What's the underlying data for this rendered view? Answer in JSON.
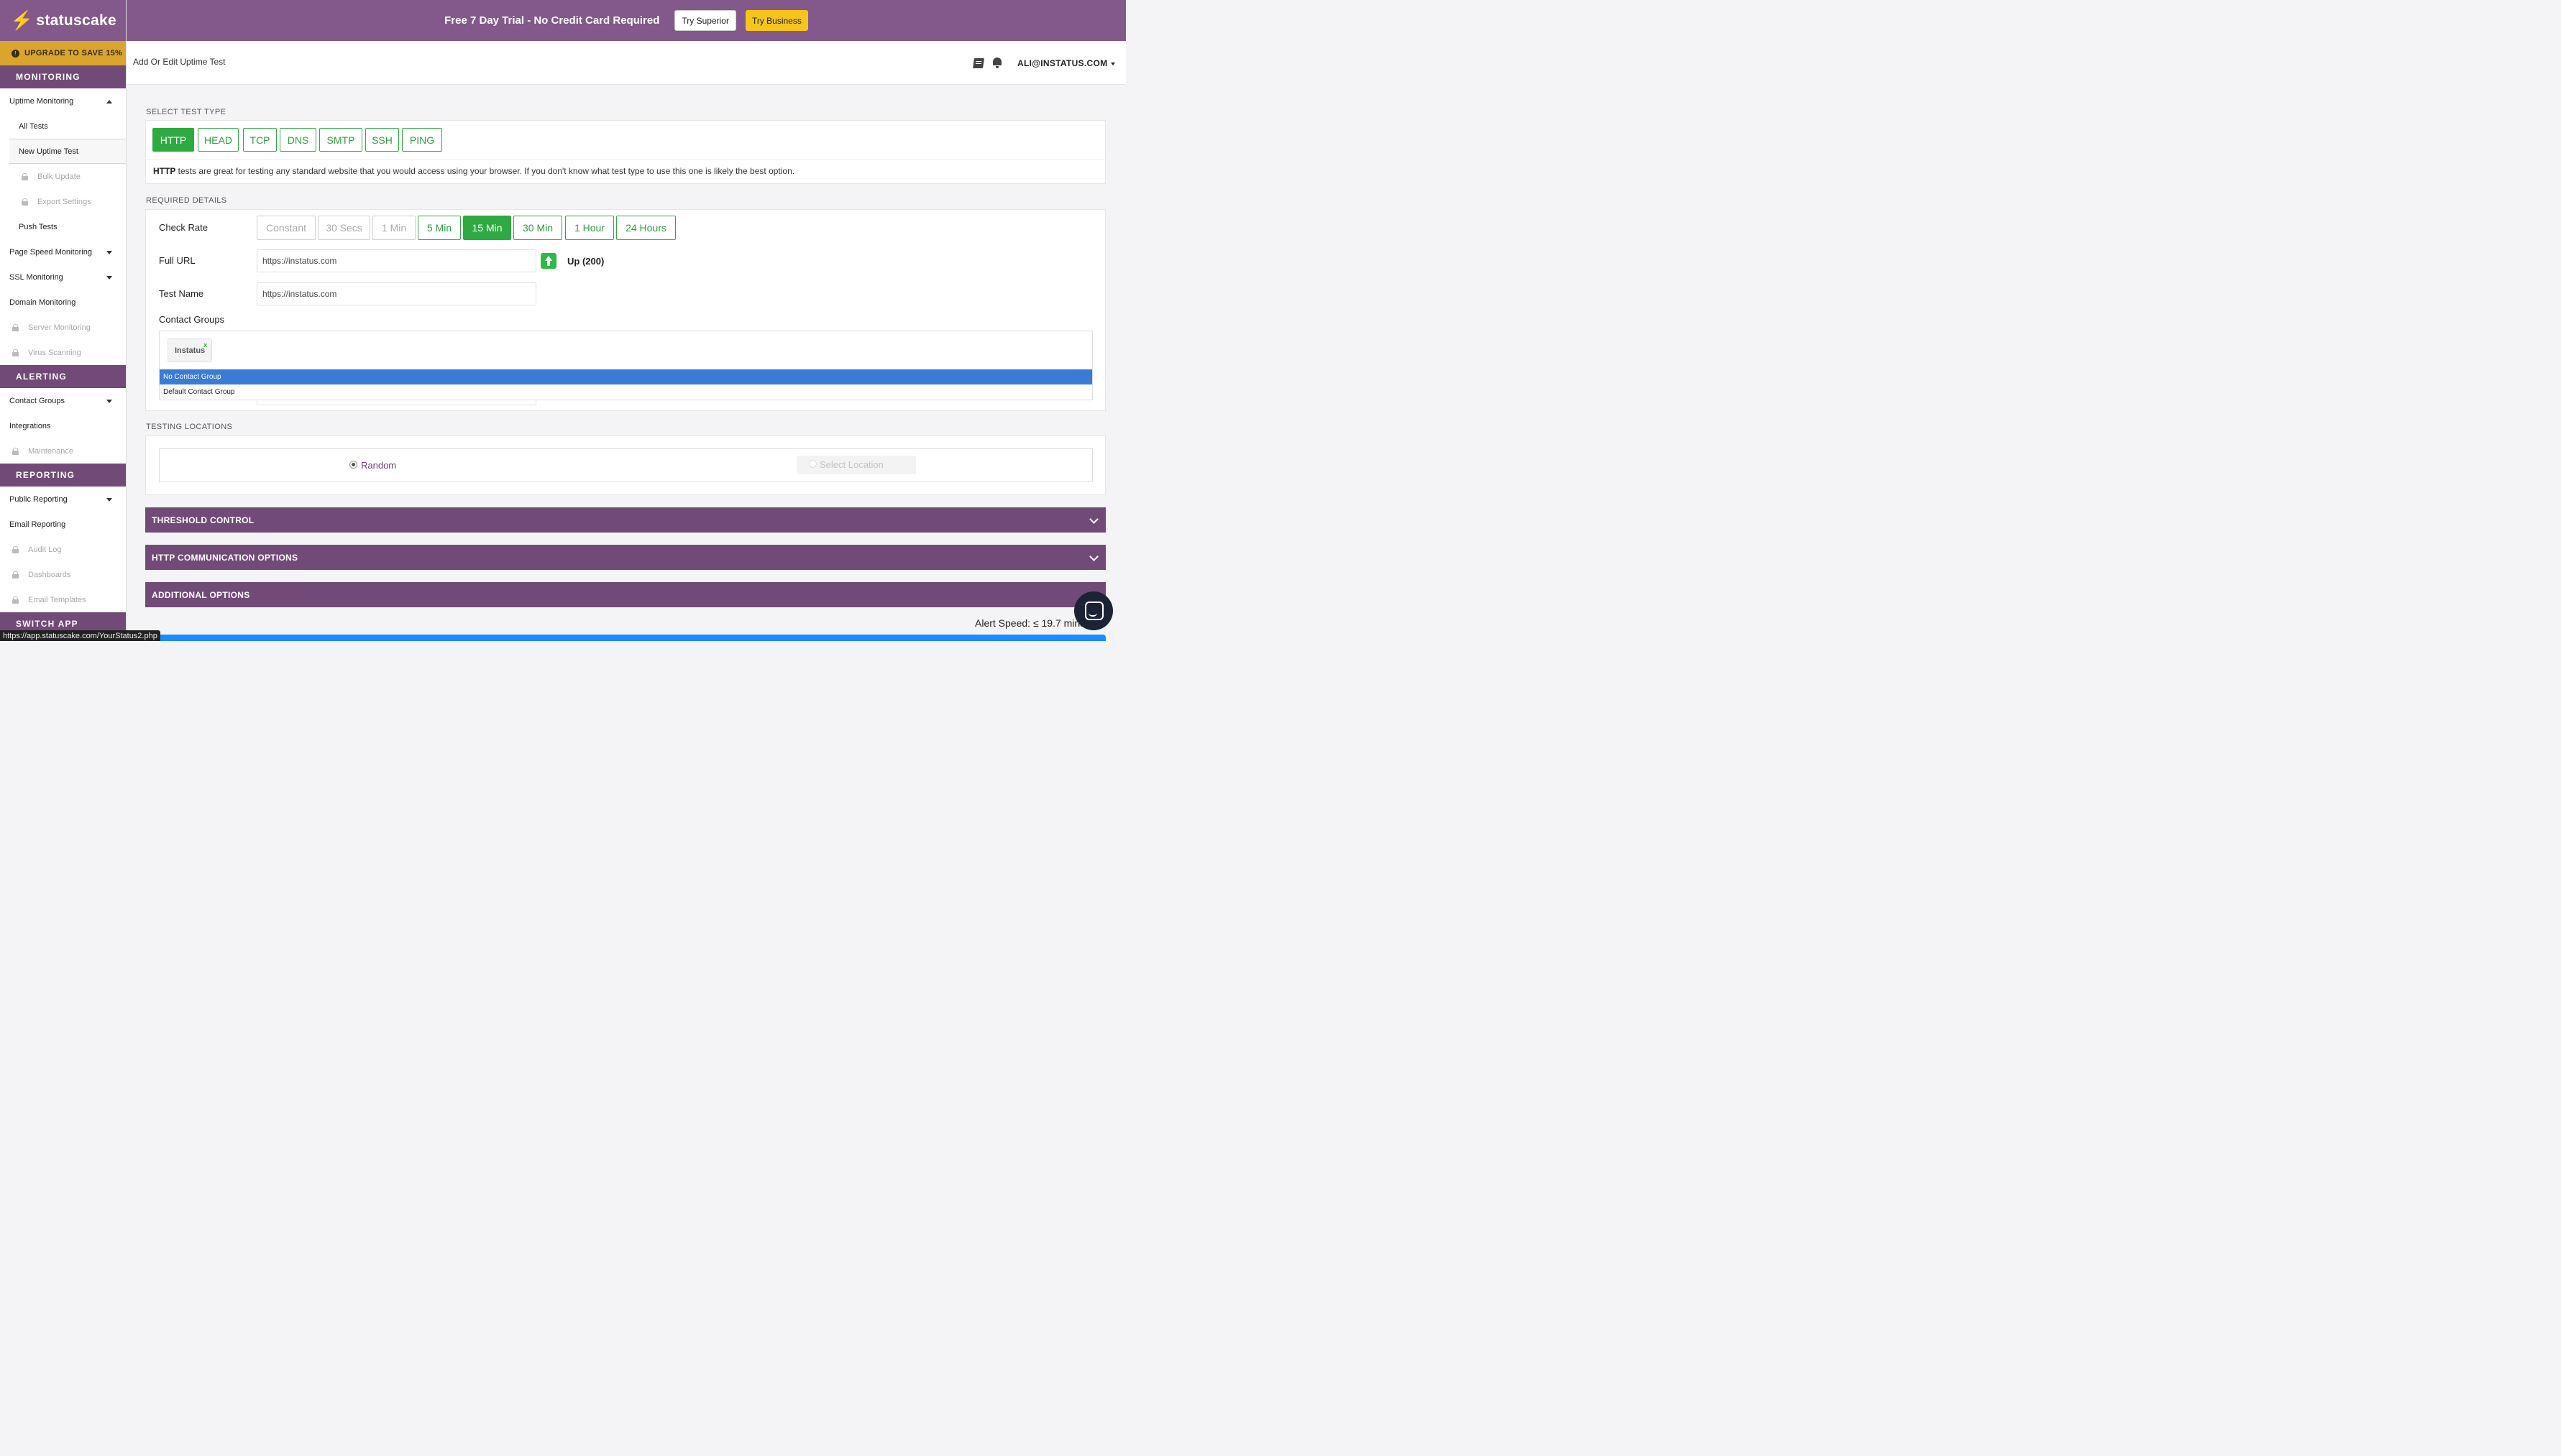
{
  "sidebar": {
    "logo_text": "statuscake",
    "upgrade_label": "UPGRADE TO SAVE 15%",
    "sections": {
      "monitoring": "MONITORING",
      "alerting": "ALERTING",
      "reporting": "REPORTING",
      "switch_app": "SWITCH APP"
    },
    "items": {
      "uptime_monitoring": "Uptime Monitoring",
      "all_tests": "All Tests",
      "new_uptime_test": "New Uptime Test",
      "bulk_update": "Bulk Update",
      "export_settings": "Export Settings",
      "push_tests": "Push Tests",
      "page_speed": "Page Speed Monitoring",
      "ssl": "SSL Monitoring",
      "domain": "Domain Monitoring",
      "server": "Server Monitoring",
      "virus": "Virus Scanning",
      "contact_groups": "Contact Groups",
      "integrations": "Integrations",
      "maintenance": "Maintenance",
      "public_reporting": "Public Reporting",
      "email_reporting": "Email Reporting",
      "audit_log": "Audit Log",
      "dashboards": "Dashboards",
      "email_templates": "Email Templates"
    }
  },
  "banner": {
    "promo": "Free 7 Day Trial - No Credit Card Required",
    "try_superior": "Try Superior",
    "try_business": "Try Business"
  },
  "header": {
    "page_title": "Add Or Edit Uptime Test",
    "user": "ALI@INSTATUS.COM"
  },
  "test_type": {
    "section_title": "SELECT TEST TYPE",
    "types": [
      "HTTP",
      "HEAD",
      "TCP",
      "DNS",
      "SMTP",
      "SSH",
      "PING"
    ],
    "selected": "HTTP",
    "desc_bold": "HTTP",
    "desc_rest": " tests are great for testing any standard website that you would access using your browser. If you don't know what test type to use this one is likely the best option."
  },
  "required": {
    "section_title": "REQUIRED DETAILS",
    "check_rate_label": "Check Rate",
    "rates": [
      "Constant",
      "30 Secs",
      "1 Min",
      "5 Min",
      "15 Min",
      "30 Min",
      "1 Hour",
      "24 Hours"
    ],
    "rate_selected": "15 Min",
    "full_url_label": "Full URL",
    "full_url_value": "https://instatus.com",
    "status": "Up (200)",
    "test_name_label": "Test Name",
    "test_name_value": "https://instatus.com",
    "contact_groups_label": "Contact Groups",
    "group_tag": "Instatus",
    "group_tag_remove": "x",
    "dropdown_options": [
      "No Contact Group",
      "Default Contact Group"
    ],
    "dropdown_highlighted": "No Contact Group"
  },
  "locations": {
    "section_title": "TESTING LOCATIONS",
    "random_label": "Random",
    "select_label": "Select Location",
    "selected": "Random"
  },
  "accordions": {
    "threshold": "THRESHOLD CONTROL",
    "http_options": "HTTP COMMUNICATION OPTIONS",
    "additional": "ADDITIONAL OPTIONS"
  },
  "alert_speed": "Alert Speed: ≤ 19.7 mins",
  "status_url": "https://app.statuscake.com/YourStatus2.php",
  "colors": {
    "brand_purple": "#83588a",
    "section_purple": "#714a77",
    "upgrade_gold": "#d9a52f",
    "accent_green": "#2eaa43",
    "highlight_blue": "#3a7bd5",
    "business_yellow": "#f6c51b"
  }
}
